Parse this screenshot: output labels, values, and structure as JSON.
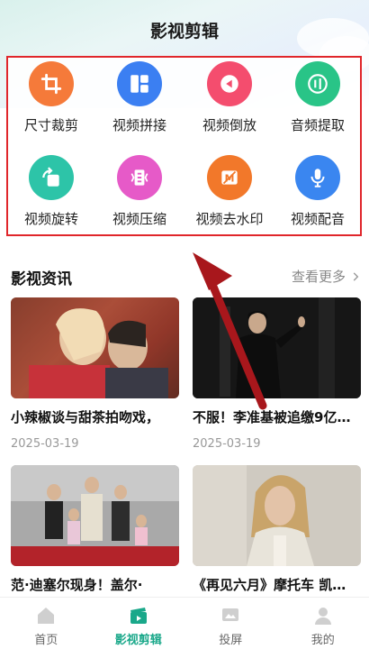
{
  "header": {
    "title": "影视剪辑"
  },
  "tools": [
    {
      "label": "尺寸裁剪",
      "icon": "crop-icon",
      "color": "#f57a3a"
    },
    {
      "label": "视频拼接",
      "icon": "grid-layout-icon",
      "color": "#3b7ff2"
    },
    {
      "label": "视频倒放",
      "icon": "rewind-icon",
      "color": "#f44d6e"
    },
    {
      "label": "音频提取",
      "icon": "audio-extract-icon",
      "color": "#29c487"
    },
    {
      "label": "视频旋转",
      "icon": "rotate-icon",
      "color": "#2dc4a8"
    },
    {
      "label": "视频压缩",
      "icon": "compress-icon",
      "color": "#e65ac8"
    },
    {
      "label": "视频去水印",
      "icon": "remove-watermark-icon",
      "color": "#f2782a"
    },
    {
      "label": "视频配音",
      "icon": "microphone-icon",
      "color": "#3a86f0"
    }
  ],
  "news": {
    "title": "影视资讯",
    "more_label": "查看更多",
    "items": [
      {
        "title": "小辣椒谈与甜茶拍吻戏，",
        "date": "2025-03-19"
      },
      {
        "title": "不服！李准基被追缴9亿…",
        "date": "2025-03-19"
      },
      {
        "title": "范·迪塞尔现身！盖尔·",
        "date": ""
      },
      {
        "title": "《再见六月》摩托车 凯…",
        "date": ""
      }
    ]
  },
  "tabbar": {
    "items": [
      {
        "label": "首页",
        "icon": "home-icon",
        "active": false
      },
      {
        "label": "影视剪辑",
        "icon": "clapperboard-icon",
        "active": true
      },
      {
        "label": "投屏",
        "icon": "cast-screen-icon",
        "active": false
      },
      {
        "label": "我的",
        "icon": "profile-icon",
        "active": false
      }
    ]
  },
  "colors": {
    "accent": "#1aa88a",
    "highlight_border": "#e0262b",
    "arrow": "#a8171c"
  }
}
